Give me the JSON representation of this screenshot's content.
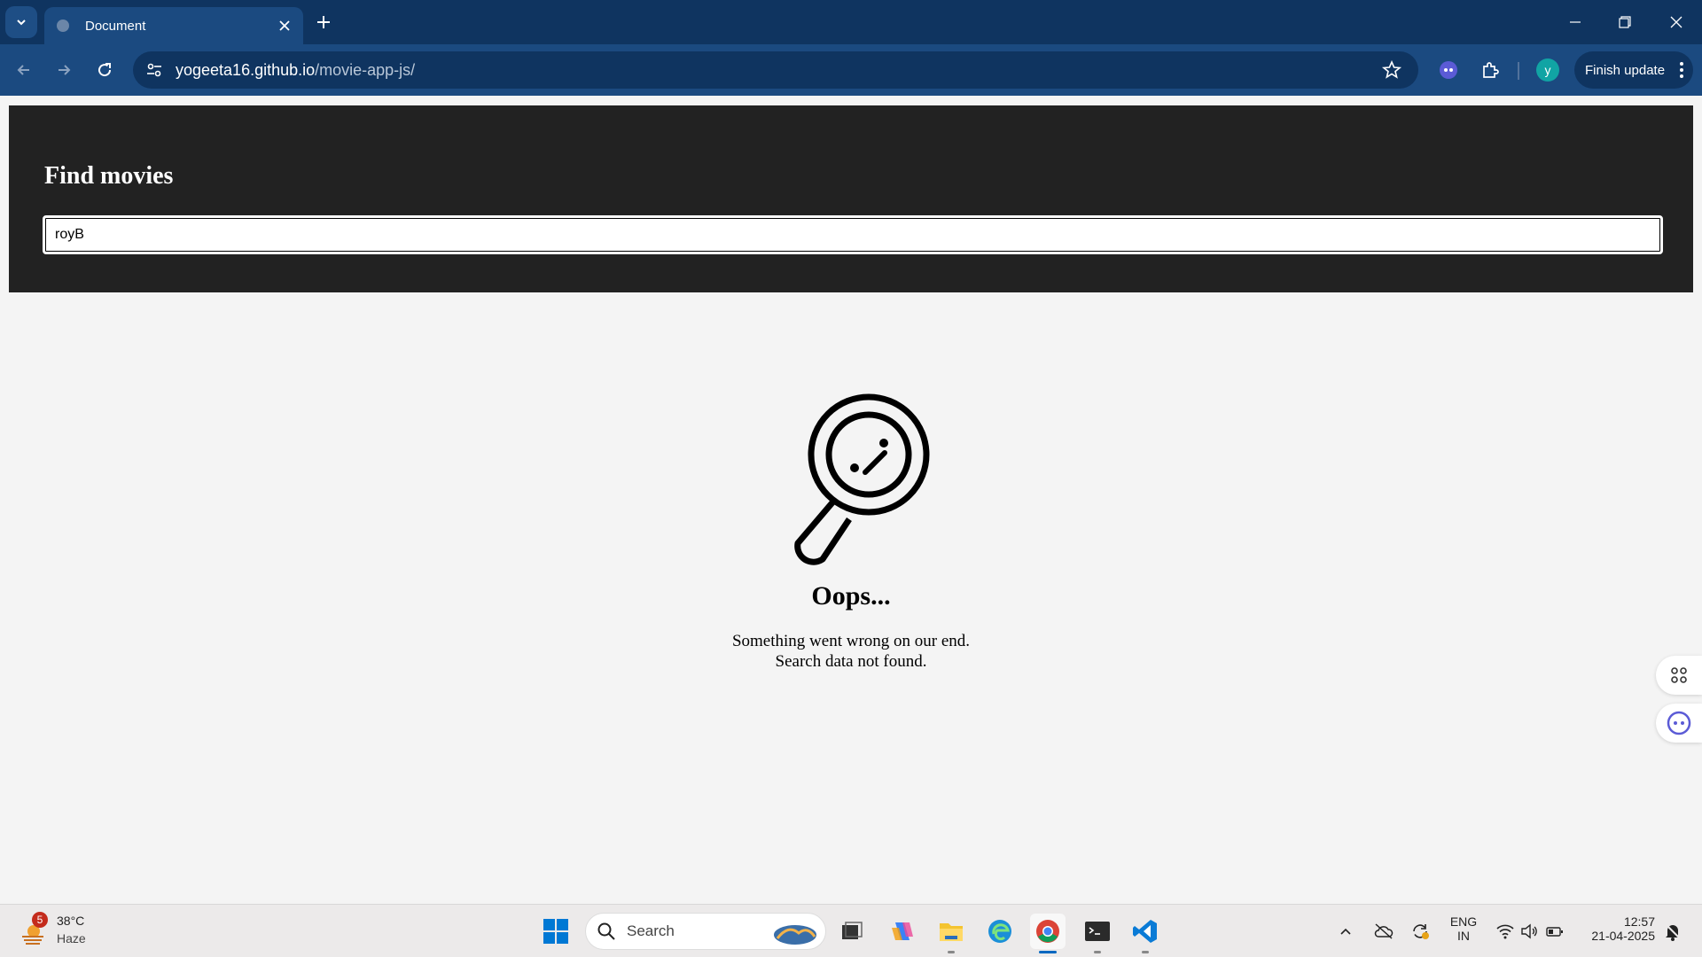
{
  "browser": {
    "tab_title": "Document",
    "url_host": "yogeeta16.github.io",
    "url_path": "/movie-app-js/",
    "profile_initial": "y",
    "finish_update_label": "Finish update"
  },
  "page": {
    "heading": "Find movies",
    "search_value": "royB",
    "empty_title": "Oops...",
    "empty_line1": "Something went wrong on our end.",
    "empty_line2": "Search data not found."
  },
  "taskbar": {
    "weather_temp": "38°C",
    "weather_condition": "Haze",
    "weather_badge": "5",
    "search_label": "Search",
    "lang_top": "ENG",
    "lang_bottom": "IN",
    "time": "12:57",
    "date": "21-04-2025"
  }
}
